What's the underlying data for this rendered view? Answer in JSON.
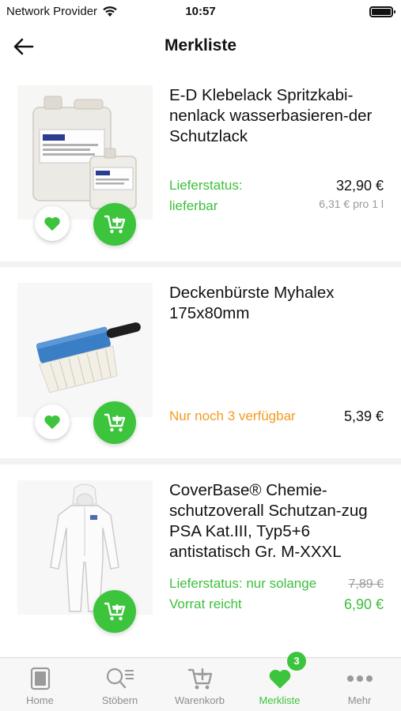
{
  "status_bar": {
    "carrier": "Network Provider",
    "time": "10:57"
  },
  "header": {
    "title": "Merkliste"
  },
  "items": [
    {
      "title": "E-D Klebelack Spritzkabi-nenlack wasserbasieren-der Schutzlack",
      "status": "Lieferstatus: lieferbar",
      "status_color": "#3cbf3c",
      "price": "32,90 €",
      "unit_price": "6,31 € pro 1 l",
      "image": "canister-icon"
    },
    {
      "title": "Deckenbürste Myhalex 175x80mm",
      "status": "Nur noch 3 verfügbar",
      "status_color": "#f59a1f",
      "price": "5,39 €",
      "image": "brush-icon"
    },
    {
      "title": "CoverBase® Chemie-schutzoverall Schutzan-zug PSA Kat.III, Typ5+6 antistatisch Gr. M-XXXL",
      "status": "Lieferstatus: nur solange Vorrat reicht",
      "status_color": "#3cbf3c",
      "old_price": "7,89 €",
      "price": "6,90 €",
      "image": "overall-icon"
    }
  ],
  "tabbar": {
    "tabs": [
      {
        "label": "Home",
        "icon": "home-icon"
      },
      {
        "label": "Stöbern",
        "icon": "search-list-icon"
      },
      {
        "label": "Warenkorb",
        "icon": "cart-icon"
      },
      {
        "label": "Merkliste",
        "icon": "heart-icon",
        "badge": "3",
        "active": true
      },
      {
        "label": "Mehr",
        "icon": "more-icon"
      }
    ]
  },
  "colors": {
    "accent": "#3cc43c",
    "warning": "#f59a1f"
  }
}
